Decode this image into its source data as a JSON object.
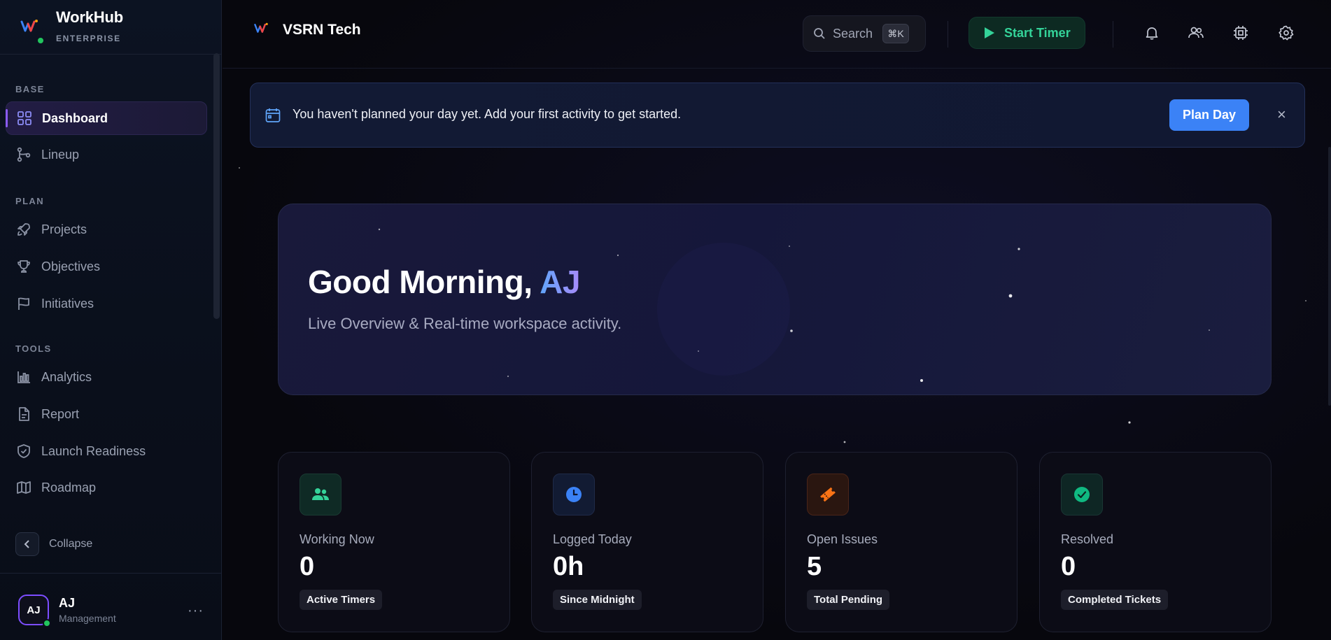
{
  "brand": {
    "name": "WorkHub",
    "tier": "ENTERPRISE"
  },
  "sidebar": {
    "sections": [
      {
        "label": "BASE"
      },
      {
        "label": "PLAN"
      },
      {
        "label": "TOOLS"
      }
    ],
    "items": [
      {
        "label": "Dashboard",
        "icon": "grid-icon",
        "active": true
      },
      {
        "label": "Lineup",
        "icon": "git-branch-icon"
      },
      {
        "label": "Projects",
        "icon": "rocket-icon"
      },
      {
        "label": "Objectives",
        "icon": "trophy-icon"
      },
      {
        "label": "Initiatives",
        "icon": "flag-icon"
      },
      {
        "label": "Analytics",
        "icon": "bar-chart-icon"
      },
      {
        "label": "Report",
        "icon": "document-icon"
      },
      {
        "label": "Launch Readiness",
        "icon": "shield-check-icon"
      },
      {
        "label": "Roadmap",
        "icon": "map-icon"
      }
    ],
    "collapse_label": "Collapse"
  },
  "user": {
    "initials": "AJ",
    "name": "AJ",
    "role": "Management",
    "more": "···"
  },
  "topbar": {
    "workspace": "VSRN Tech",
    "search_label": "Search",
    "search_shortcut": "⌘K",
    "timer_label": "Start Timer"
  },
  "banner": {
    "message": "You haven't planned your day yet. Add your first activity to get started.",
    "action": "Plan Day",
    "close": "×"
  },
  "hero": {
    "greeting": "Good Morning, ",
    "name": "AJ",
    "subtitle": "Live Overview & Real-time workspace activity."
  },
  "stats": [
    {
      "label": "Working Now",
      "value": "0",
      "badge": "Active Timers",
      "color": "#34d399",
      "bg": "#0f2a25",
      "border": "#1a3a32",
      "icon": "users-icon"
    },
    {
      "label": "Logged Today",
      "value": "0h",
      "badge": "Since Midnight",
      "color": "#3b82f6",
      "bg": "#121b33",
      "border": "#1f2a48",
      "icon": "clock-icon"
    },
    {
      "label": "Open Issues",
      "value": "5",
      "badge": "Total Pending",
      "color": "#f97316",
      "bg": "#2a1610",
      "border": "#4a2518",
      "icon": "ticket-icon"
    },
    {
      "label": "Resolved",
      "value": "0",
      "badge": "Completed Tickets",
      "color": "#10b981",
      "bg": "#0e2624",
      "border": "#1a3634",
      "icon": "check-circle-icon"
    }
  ]
}
